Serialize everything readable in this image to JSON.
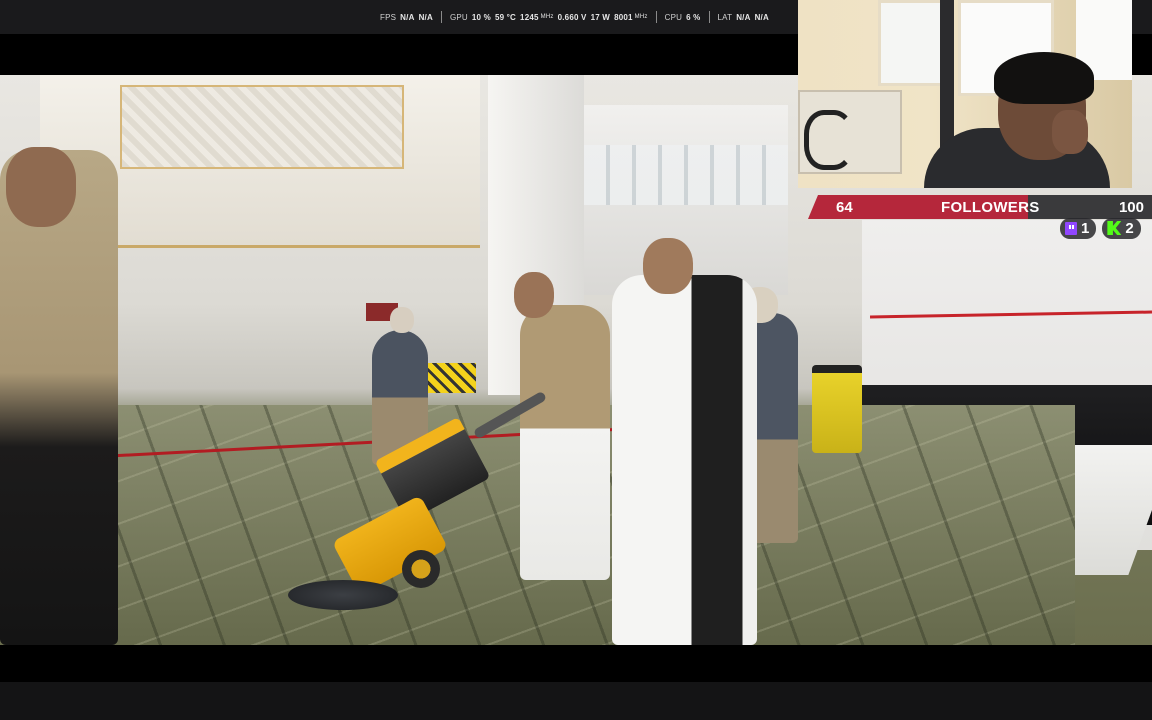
{
  "stats_overlay": {
    "fps_label": "FPS",
    "fps_value_1": "N/A",
    "fps_value_2": "N/A",
    "gpu_label": "GPU",
    "gpu_usage": "10 %",
    "gpu_temp": "59 °C",
    "gpu_clock": "1245",
    "gpu_clock_unit": "MHz",
    "gpu_voltage": "0.660 V",
    "gpu_power": "17 W",
    "gpu_mem_clock": "8001",
    "gpu_mem_unit": "MHz",
    "cpu_label": "CPU",
    "cpu_usage": "6 %",
    "lat_label": "LAT",
    "lat_value_1": "N/A",
    "lat_value_2": "N/A"
  },
  "follower_goal": {
    "current": "64",
    "label": "FOLLOWERS",
    "goal": "100",
    "progress": 0.64
  },
  "platforms": [
    {
      "icon": "twitch-icon",
      "count": "1"
    },
    {
      "icon": "kick-icon",
      "count": "2"
    }
  ],
  "colors": {
    "goal_bar": "#b5273b",
    "twitch": "#9146ff",
    "kick": "#53fc18"
  }
}
